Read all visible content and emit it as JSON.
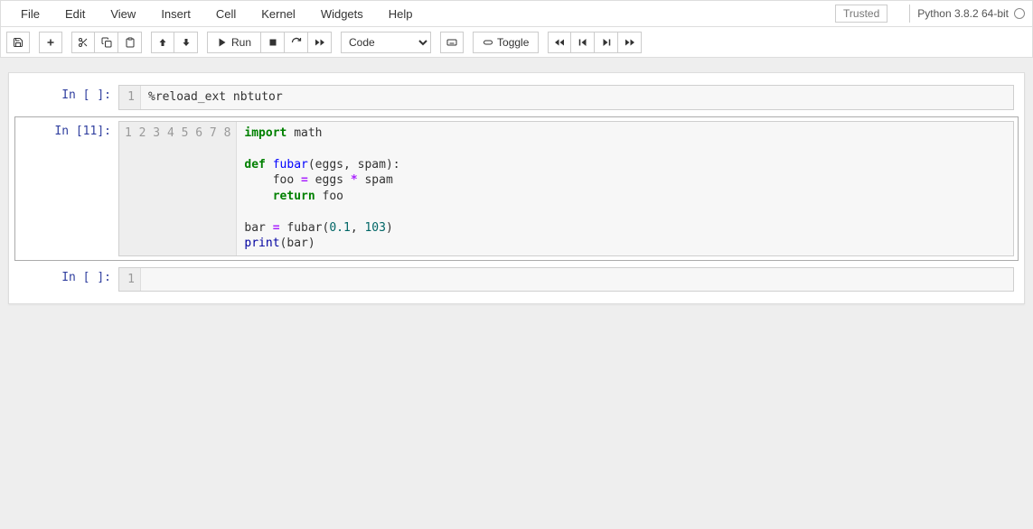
{
  "menubar": {
    "items": [
      "File",
      "Edit",
      "View",
      "Insert",
      "Cell",
      "Kernel",
      "Widgets",
      "Help"
    ],
    "trusted": "Trusted",
    "kernel": "Python 3.8.2 64-bit"
  },
  "toolbar": {
    "run_label": "Run",
    "toggle_label": "Toggle",
    "celltype": "Code"
  },
  "cells": [
    {
      "prompt": "In [ ]:",
      "lines": [
        "1"
      ],
      "code_html": "%reload_ext nbtutor",
      "tokens": [
        [
          {
            "t": "%reload_ext",
            "c": ""
          },
          {
            "t": " nbtutor",
            "c": ""
          }
        ]
      ],
      "selected": false
    },
    {
      "prompt": "In [11]:",
      "lines": [
        "1",
        "2",
        "3",
        "4",
        "5",
        "6",
        "7",
        "8"
      ],
      "tokens": [
        [
          {
            "t": "import",
            "c": "cm-keyword"
          },
          {
            "t": " math",
            "c": ""
          }
        ],
        [
          {
            "t": "",
            "c": ""
          }
        ],
        [
          {
            "t": "def",
            "c": "cm-keyword"
          },
          {
            "t": " ",
            "c": ""
          },
          {
            "t": "fubar",
            "c": "cm-def"
          },
          {
            "t": "(eggs, spam):",
            "c": ""
          }
        ],
        [
          {
            "t": "    foo ",
            "c": ""
          },
          {
            "t": "=",
            "c": "cm-op"
          },
          {
            "t": " eggs ",
            "c": ""
          },
          {
            "t": "*",
            "c": "cm-op"
          },
          {
            "t": " spam",
            "c": ""
          }
        ],
        [
          {
            "t": "    ",
            "c": ""
          },
          {
            "t": "return",
            "c": "cm-keyword"
          },
          {
            "t": " foo",
            "c": ""
          }
        ],
        [
          {
            "t": "",
            "c": ""
          }
        ],
        [
          {
            "t": "bar ",
            "c": ""
          },
          {
            "t": "=",
            "c": "cm-op"
          },
          {
            "t": " fubar(",
            "c": ""
          },
          {
            "t": "0.1",
            "c": "cm-num"
          },
          {
            "t": ", ",
            "c": ""
          },
          {
            "t": "103",
            "c": "cm-num"
          },
          {
            "t": ")",
            "c": ""
          }
        ],
        [
          {
            "t": "print",
            "c": "cm-builtin"
          },
          {
            "t": "(bar)",
            "c": ""
          }
        ]
      ],
      "selected": true
    },
    {
      "prompt": "In [ ]:",
      "lines": [
        "1"
      ],
      "tokens": [
        [
          {
            "t": "",
            "c": ""
          }
        ]
      ],
      "selected": false
    }
  ]
}
